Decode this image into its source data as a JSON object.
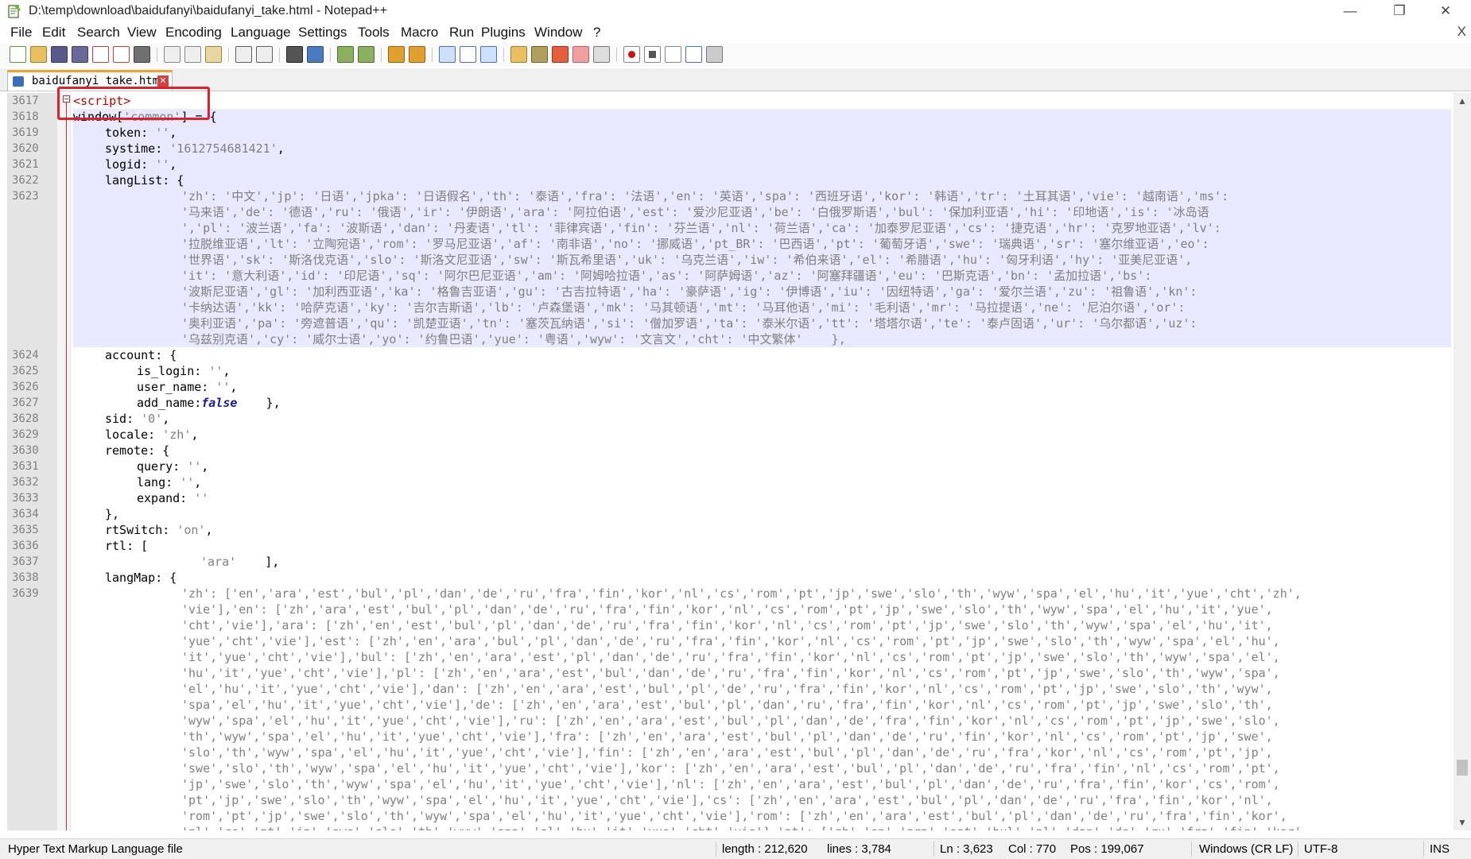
{
  "window": {
    "title": "D:\\temp\\download\\baidufanyi\\baidufanyi_take.html - Notepad++",
    "minimize": "—",
    "maximize": "❐",
    "close": "✕"
  },
  "menu": {
    "items": [
      "File",
      "Edit",
      "Search",
      "View",
      "Encoding",
      "Language",
      "Settings",
      "Tools",
      "Macro",
      "Run",
      "Plugins",
      "Window",
      "?"
    ],
    "close_doc": "X"
  },
  "tab": {
    "label": "baidufanyi_take.html",
    "close": "✕"
  },
  "gutter": {
    "line_numbers": [
      "3617",
      "3618",
      "3619",
      "3620",
      "3621",
      "3622",
      "3623",
      "3624",
      "3625",
      "3626",
      "3627",
      "3628",
      "3629",
      "3630",
      "3631",
      "3632",
      "3633",
      "3634",
      "3635",
      "3636",
      "3637",
      "3638",
      "3639"
    ]
  },
  "code": {
    "l3617": "<script>",
    "l3618_a": "window[",
    "l3618_b": "'common'",
    "l3618_c": "] = {",
    "l3619_a": "token: ",
    "l3619_b": "''",
    "l3619_c": ",",
    "l3620_a": "systime: ",
    "l3620_b": "'1612754681421'",
    "l3620_c": ",",
    "l3621_a": "logid: ",
    "l3621_b": "''",
    "l3621_c": ",",
    "l3622": "langList: {",
    "l3623_rows": [
      "'zh': '中文','jp': '日语','jpka': '日语假名','th': '泰语','fra': '法语','en': '英语','spa': '西班牙语','kor': '韩语','tr': '土耳其语','vie': '越南语','ms':",
      "'马来语','de': '德语','ru': '俄语','ir': '伊朗语','ara': '阿拉伯语','est': '爱沙尼亚语','be': '白俄罗斯语','bul': '保加利亚语','hi': '印地语','is': '冰岛语",
      "','pl': '波兰语','fa': '波斯语','dan': '丹麦语','tl': '菲律宾语','fin': '芬兰语','nl': '荷兰语','ca': '加泰罗尼亚语','cs': '捷克语','hr': '克罗地亚语','lv':",
      "'拉脱维亚语','lt': '立陶宛语','rom': '罗马尼亚语','af': '南非语','no': '挪威语','pt_BR': '巴西语','pt': '葡萄牙语','swe': '瑞典语','sr': '塞尔维亚语','eo':",
      "'世界语','sk': '斯洛伐克语','slo': '斯洛文尼亚语','sw': '斯瓦希里语','uk': '乌克兰语','iw': '希伯来语','el': '希腊语','hu': '匈牙利语','hy': '亚美尼亚语',",
      "'it': '意大利语','id': '印尼语','sq': '阿尔巴尼亚语','am': '阿姆哈拉语','as': '阿萨姆语','az': '阿塞拜疆语','eu': '巴斯克语','bn': '孟加拉语','bs':",
      "'波斯尼亚语','gl': '加利西亚语','ka': '格鲁吉亚语','gu': '古吉拉特语','ha': '豪萨语','ig': '伊博语','iu': '因纽特语','ga': '爱尔兰语','zu': '祖鲁语','kn':",
      "'卡纳达语','kk': '哈萨克语','ky': '吉尔吉斯语','lb': '卢森堡语','mk': '马其顿语','mt': '马耳他语','mi': '毛利语','mr': '马拉提语','ne': '尼泊尔语','or':",
      "'奥利亚语','pa': '旁遮普语','qu': '凯楚亚语','tn': '塞茨瓦纳语','si': '僧加罗语','ta': '泰米尔语','tt': '塔塔尔语','te': '泰卢固语','ur': '乌尔都语','uz':",
      "'乌兹别克语','cy': '威尔士语','yo': '约鲁巴语','yue': '粤语','wyw': '文言文','cht': '中文繁体'    },"
    ],
    "l3624": "account: {",
    "l3625_a": "is_login: ",
    "l3625_b": "''",
    "l3625_c": ",",
    "l3626_a": "user_name: ",
    "l3626_b": "''",
    "l3626_c": ",",
    "l3627_a": "add_name:",
    "l3627_b": "false",
    "l3627_c": "    },",
    "l3628_a": "sid: ",
    "l3628_b": "'0'",
    "l3628_c": ",",
    "l3629_a": "locale: ",
    "l3629_b": "'zh'",
    "l3629_c": ",",
    "l3630": "remote: {",
    "l3631_a": "query: ",
    "l3631_b": "''",
    "l3631_c": ",",
    "l3632_a": "lang: ",
    "l3632_b": "''",
    "l3632_c": ",",
    "l3633_a": "expand: ",
    "l3633_b": "''",
    "l3634": "},",
    "l3635_a": "rtSwitch: ",
    "l3635_b": "'on'",
    "l3635_c": ",",
    "l3636": "rtl: [",
    "l3637_a": "'ara'",
    "l3637_b": "    ],",
    "l3638": "langMap: {",
    "l3639_rows": [
      "'zh': ['en','ara','est','bul','pl','dan','de','ru','fra','fin','kor','nl','cs','rom','pt','jp','swe','slo','th','wyw','spa','el','hu','it','yue','cht','zh',",
      "'vie'],'en': ['zh','ara','est','bul','pl','dan','de','ru','fra','fin','kor','nl','cs','rom','pt','jp','swe','slo','th','wyw','spa','el','hu','it','yue',",
      "'cht','vie'],'ara': ['zh','en','est','bul','pl','dan','de','ru','fra','fin','kor','nl','cs','rom','pt','jp','swe','slo','th','wyw','spa','el','hu','it',",
      "'yue','cht','vie'],'est': ['zh','en','ara','bul','pl','dan','de','ru','fra','fin','kor','nl','cs','rom','pt','jp','swe','slo','th','wyw','spa','el','hu',",
      "'it','yue','cht','vie'],'bul': ['zh','en','ara','est','pl','dan','de','ru','fra','fin','kor','nl','cs','rom','pt','jp','swe','slo','th','wyw','spa','el',",
      "'hu','it','yue','cht','vie'],'pl': ['zh','en','ara','est','bul','dan','de','ru','fra','fin','kor','nl','cs','rom','pt','jp','swe','slo','th','wyw','spa',",
      "'el','hu','it','yue','cht','vie'],'dan': ['zh','en','ara','est','bul','pl','de','ru','fra','fin','kor','nl','cs','rom','pt','jp','swe','slo','th','wyw',",
      "'spa','el','hu','it','yue','cht','vie'],'de': ['zh','en','ara','est','bul','pl','dan','ru','fra','fin','kor','nl','cs','rom','pt','jp','swe','slo','th',",
      "'wyw','spa','el','hu','it','yue','cht','vie'],'ru': ['zh','en','ara','est','bul','pl','dan','de','fra','fin','kor','nl','cs','rom','pt','jp','swe','slo',",
      "'th','wyw','spa','el','hu','it','yue','cht','vie'],'fra': ['zh','en','ara','est','bul','pl','dan','de','ru','fin','kor','nl','cs','rom','pt','jp','swe',",
      "'slo','th','wyw','spa','el','hu','it','yue','cht','vie'],'fin': ['zh','en','ara','est','bul','pl','dan','de','ru','fra','kor','nl','cs','rom','pt','jp',",
      "'swe','slo','th','wyw','spa','el','hu','it','yue','cht','vie'],'kor': ['zh','en','ara','est','bul','pl','dan','de','ru','fra','fin','nl','cs','rom','pt',",
      "'jp','swe','slo','th','wyw','spa','el','hu','it','yue','cht','vie'],'nl': ['zh','en','ara','est','bul','pl','dan','de','ru','fra','fin','kor','cs','rom',",
      "'pt','jp','swe','slo','th','wyw','spa','el','hu','it','yue','cht','vie'],'cs': ['zh','en','ara','est','bul','pl','dan','de','ru','fra','fin','kor','nl',",
      "'rom','pt','jp','swe','slo','th','wyw','spa','el','hu','it','yue','cht','vie'],'rom': ['zh','en','ara','est','bul','pl','dan','de','ru','fra','fin','kor',",
      "'nl','cs','pt','jp','swe','slo','th','wyw','spa','el','hu','it','yue','cht','vie'],'pt': ['zh','en','ara','est','bul','pl','dan','de','ru','fra','fin','kor',"
    ]
  },
  "status": {
    "file_type": "Hyper Text Markup Language file",
    "length": "length : 212,620",
    "lines": "lines : 3,784",
    "ln": "Ln : 3,623",
    "col": "Col : 770",
    "pos": "Pos : 199,067",
    "eol": "Windows (CR LF)",
    "encoding": "UTF-8",
    "mode": "INS"
  }
}
